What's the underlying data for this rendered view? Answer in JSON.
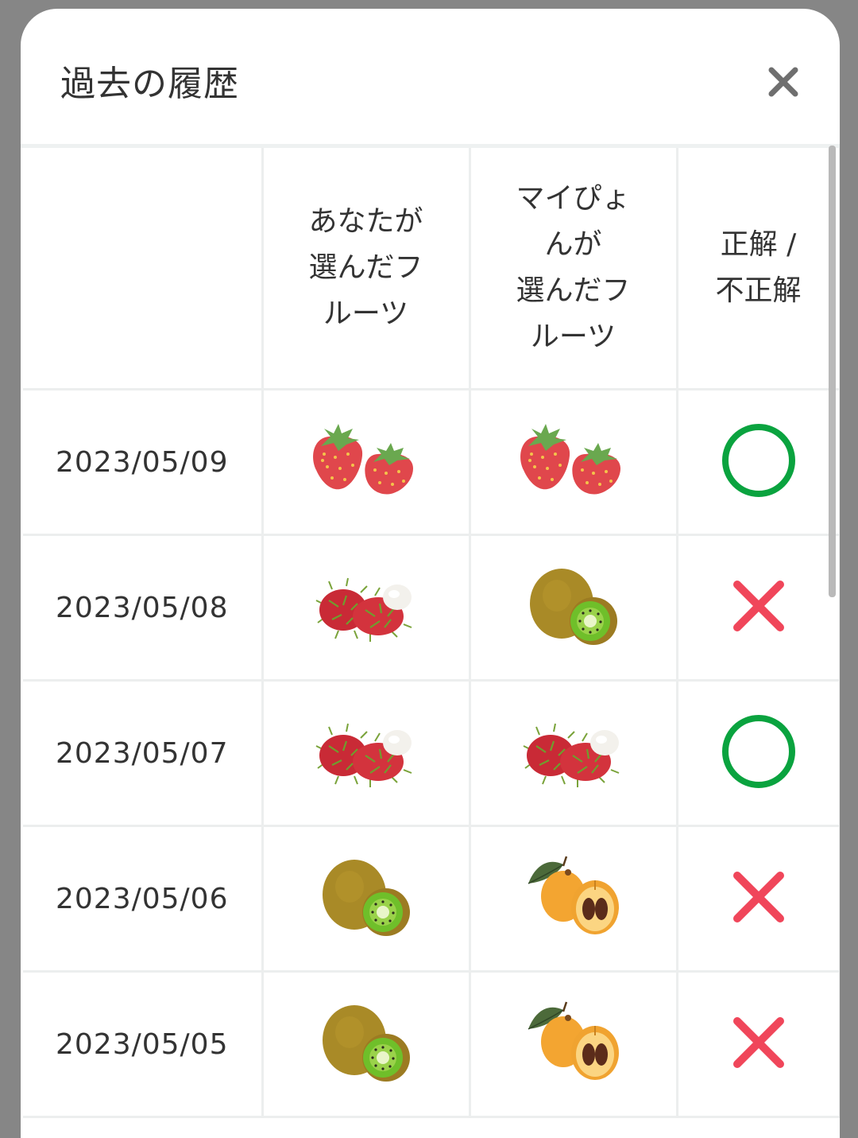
{
  "modal": {
    "title": "過去の履歴",
    "close_icon": "close-icon"
  },
  "table": {
    "headers": {
      "date": "",
      "your_fruit_lines": [
        "あなたが",
        "選んだフ",
        "ルーツ"
      ],
      "mypyon_fruit_lines": [
        "マイぴょ",
        "んが",
        "選んだフ",
        "ルーツ"
      ],
      "result_lines": [
        "正解 /",
        "不正解"
      ]
    },
    "rows": [
      {
        "date": "2023/05/09",
        "your_fruit": "strawberry",
        "mypyon_fruit": "strawberry",
        "result": "correct"
      },
      {
        "date": "2023/05/08",
        "your_fruit": "rambutan",
        "mypyon_fruit": "kiwi",
        "result": "incorrect"
      },
      {
        "date": "2023/05/07",
        "your_fruit": "rambutan",
        "mypyon_fruit": "rambutan",
        "result": "correct"
      },
      {
        "date": "2023/05/06",
        "your_fruit": "kiwi",
        "mypyon_fruit": "loquat",
        "result": "incorrect"
      },
      {
        "date": "2023/05/05",
        "your_fruit": "kiwi",
        "mypyon_fruit": "loquat",
        "result": "incorrect"
      }
    ]
  },
  "colors": {
    "correct": "#0aa33f",
    "incorrect": "#f0465a",
    "close_icon": "#6f6f6f"
  }
}
